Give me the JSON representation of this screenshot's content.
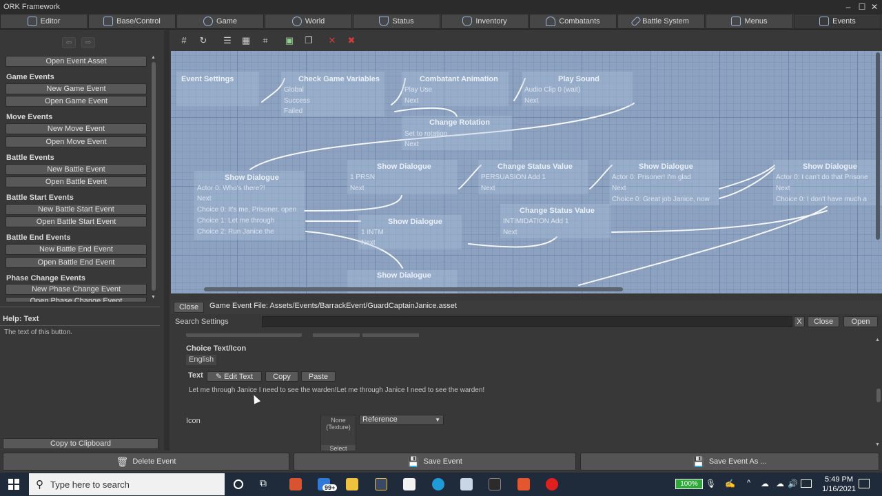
{
  "window": {
    "title": "ORK Framework"
  },
  "tabs": [
    "Editor",
    "Base/Control",
    "Game",
    "World",
    "Status",
    "Inventory",
    "Combatants",
    "Battle System",
    "Menus",
    "Events"
  ],
  "left": {
    "open_event_asset": "Open Event Asset",
    "sections": [
      {
        "title": "Game Events",
        "new": "New Game Event",
        "open": "Open Game Event"
      },
      {
        "title": "Move Events",
        "new": "New Move Event",
        "open": "Open Move Event"
      },
      {
        "title": "Battle Events",
        "new": "New Battle Event",
        "open": "Open Battle Event"
      },
      {
        "title": "Battle Start Events",
        "new": "New Battle Start Event",
        "open": "Open Battle Start Event"
      },
      {
        "title": "Battle End Events",
        "new": "New Battle End Event",
        "open": "Open Battle End Event"
      },
      {
        "title": "Phase Change Events",
        "new": "New Phase Change Event",
        "open": "Open Phase Change Event"
      }
    ],
    "help_title": "Help: Text",
    "help_text": "The text of this button.",
    "copy_clipboard": "Copy to Clipboard"
  },
  "graph": {
    "nodes": [
      {
        "title": "Event Settings",
        "lines": []
      },
      {
        "title": "Check Game Variables",
        "lines": [
          "Global",
          "Success",
          "Failed"
        ]
      },
      {
        "title": "Combatant Animation",
        "lines": [
          "Play Use",
          "Next"
        ]
      },
      {
        "title": "Play Sound",
        "lines": [
          "Audio Clip 0 (wait)",
          "Next"
        ]
      },
      {
        "title": "Change Rotation",
        "lines": [
          "Set to rotation",
          "Next"
        ]
      },
      {
        "title": "Show Dialogue",
        "lines": [
          "Actor 0: Who's there?!",
          "Next",
          "Choice 0: It's me, Prisoner, open",
          "Choice 1: Let me through",
          "Choice 2: Run Janice the"
        ]
      },
      {
        "title": "Show Dialogue",
        "lines": [
          "1 PRSN",
          "Next"
        ]
      },
      {
        "title": "Change Status Value",
        "lines": [
          "PERSUASION Add 1",
          "Next"
        ]
      },
      {
        "title": "Show Dialogue",
        "lines": [
          "Actor 0: Prisoner! I'm glad",
          "Next",
          "Choice 0: Great job Janice, now"
        ]
      },
      {
        "title": "Show Dialogue",
        "lines": [
          "Actor 0: I can't do that Prisone",
          "Next",
          "Choice 0: I don't have much a"
        ]
      },
      {
        "title": "Change Status Value",
        "lines": [
          "INTIMIDATION Add 1",
          "Next"
        ]
      },
      {
        "title": "Show Dialogue",
        "lines": [
          "1 INTM",
          "Next"
        ]
      },
      {
        "title": "Show Dialogue",
        "lines": []
      }
    ]
  },
  "file_bar": {
    "close": "Close",
    "path": "Game Event File: Assets/Events/BarrackEvent/GuardCaptainJanice.asset"
  },
  "search_bar": {
    "label": "Search Settings",
    "value": "",
    "clear": "X",
    "close": "Close",
    "open": "Open"
  },
  "editor": {
    "choice_label": "Choice Text/Icon",
    "language": "English",
    "text_label": "Text",
    "edit_text": "Edit Text",
    "copy": "Copy",
    "paste": "Paste",
    "text_value": "Let me through Janice I need to see the warden!Let me through Janice I need to see the warden!",
    "icon_label": "Icon",
    "icon_none": "None\n(Texture)",
    "icon_select": "Select",
    "reference": "Reference"
  },
  "bottom": {
    "delete": "Delete Event",
    "save": "Save Event",
    "save_as": "Save Event As ..."
  },
  "taskbar": {
    "search_placeholder": "Type here to search",
    "badge": "99+",
    "battery": "100%",
    "time": "5:49 PM",
    "date": "1/16/2021"
  }
}
